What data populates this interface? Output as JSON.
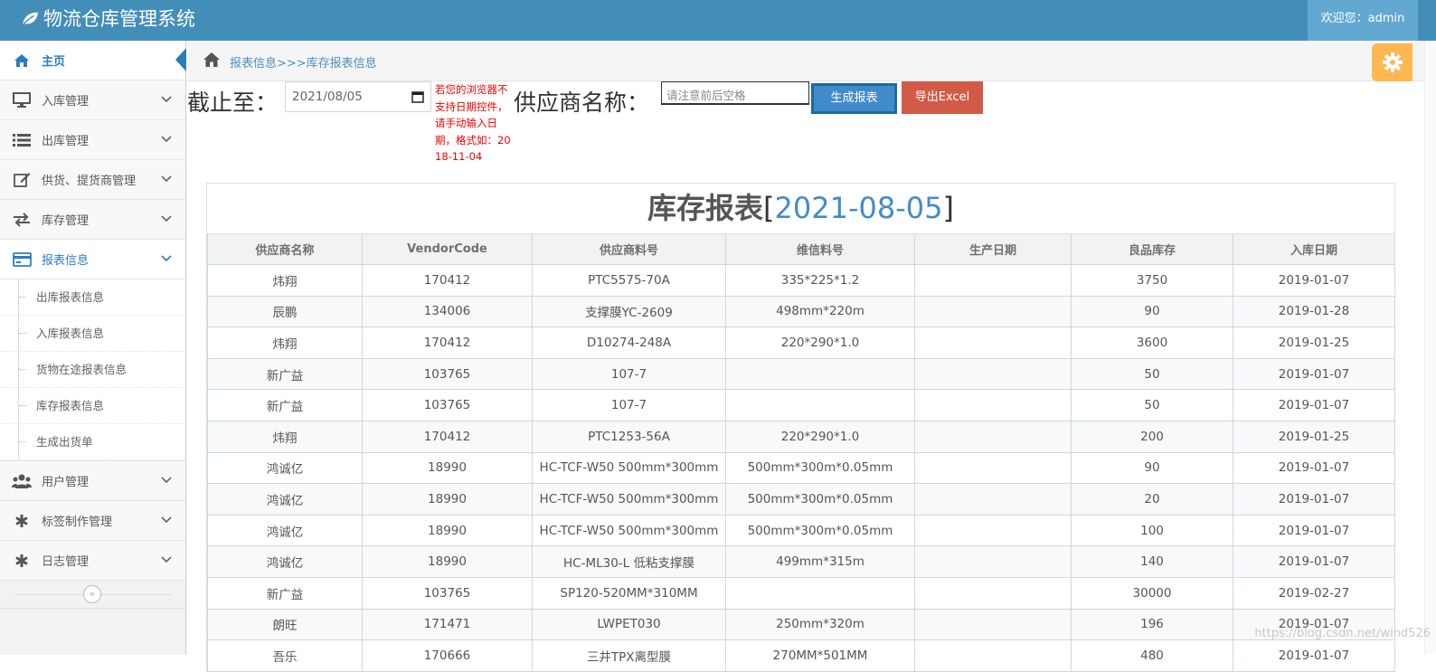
{
  "app": {
    "title": "物流仓库管理系统",
    "welcome": "欢迎您：admin"
  },
  "sidebar": {
    "items": [
      {
        "label": "主页",
        "icon": "home-icon"
      },
      {
        "label": "入库管理",
        "icon": "desktop-icon"
      },
      {
        "label": "出库管理",
        "icon": "list-icon"
      },
      {
        "label": "供货、提货商管理",
        "icon": "edit-icon"
      },
      {
        "label": "库存管理",
        "icon": "exchange-icon"
      },
      {
        "label": "报表信息",
        "icon": "credit-card-icon"
      },
      {
        "label": "用户管理",
        "icon": "users-icon"
      },
      {
        "label": "标签制作管理",
        "icon": "asterisk-icon"
      },
      {
        "label": "日志管理",
        "icon": "asterisk-icon"
      }
    ],
    "report_submenu": [
      "出库报表信息",
      "入库报表信息",
      "货物在途报表信息",
      "库存报表信息",
      "生成出货单"
    ]
  },
  "breadcrumb": {
    "text": "报表信息>>>库存报表信息"
  },
  "form": {
    "date_label": "截止至：",
    "date_value": "2021/08/05",
    "hint": "若您的浏览器不支持日期控件，请手动输入日期，格式如：2018-11-04",
    "vendor_label": "供应商名称：",
    "vendor_placeholder": "请注意前后空格",
    "generate_button": "生成报表",
    "export_button": "导出Excel"
  },
  "report": {
    "title": "库存报表",
    "bracket_open": "[",
    "date": "2021-08-05",
    "bracket_close": "]",
    "columns": [
      "供应商名称",
      "VendorCode",
      "供应商料号",
      "维信料号",
      "生产日期",
      "良品库存",
      "入库日期"
    ],
    "rows": [
      [
        "炜翔",
        "170412",
        "PTC5575-70A",
        "335*225*1.2",
        "",
        "3750",
        "2019-01-07"
      ],
      [
        "辰鹏",
        "134006",
        "支撑膜YC-2609",
        "498mm*220m",
        "",
        "90",
        "2019-01-28"
      ],
      [
        "炜翔",
        "170412",
        "D10274-248A",
        "220*290*1.0",
        "",
        "3600",
        "2019-01-25"
      ],
      [
        "新广益",
        "103765",
        "107-7",
        "",
        "",
        "50",
        "2019-01-07"
      ],
      [
        "新广益",
        "103765",
        "107-7",
        "",
        "",
        "50",
        "2019-01-07"
      ],
      [
        "炜翔",
        "170412",
        "PTC1253-56A",
        "220*290*1.0",
        "",
        "200",
        "2019-01-25"
      ],
      [
        "鸿诚亿",
        "18990",
        "HC-TCF-W50 500mm*300mm",
        "500mm*300m*0.05mm",
        "",
        "90",
        "2019-01-07"
      ],
      [
        "鸿诚亿",
        "18990",
        "HC-TCF-W50 500mm*300mm",
        "500mm*300m*0.05mm",
        "",
        "20",
        "2019-01-07"
      ],
      [
        "鸿诚亿",
        "18990",
        "HC-TCF-W50 500mm*300mm",
        "500mm*300m*0.05mm",
        "",
        "100",
        "2019-01-07"
      ],
      [
        "鸿诚亿",
        "18990",
        "HC-ML30-L 低粘支撑膜",
        "499mm*315m",
        "",
        "140",
        "2019-01-07"
      ],
      [
        "新广益",
        "103765",
        "SP120-520MM*310MM",
        "",
        "",
        "30000",
        "2019-02-27"
      ],
      [
        "朗旺",
        "171471",
        "LWPET030",
        "250mm*320m",
        "",
        "196",
        "2019-01-07"
      ],
      [
        "吾乐",
        "170666",
        "三井TPX离型膜",
        "270MM*501MM",
        "",
        "480",
        "2019-01-07"
      ]
    ]
  },
  "watermark": "https://blog.csdn.net/wind526",
  "colors": {
    "header": "#438eb9",
    "accent": "#2b7dbc",
    "primary_button": "#428bca",
    "danger_button": "#d15b47",
    "settings": "#ffb752"
  }
}
